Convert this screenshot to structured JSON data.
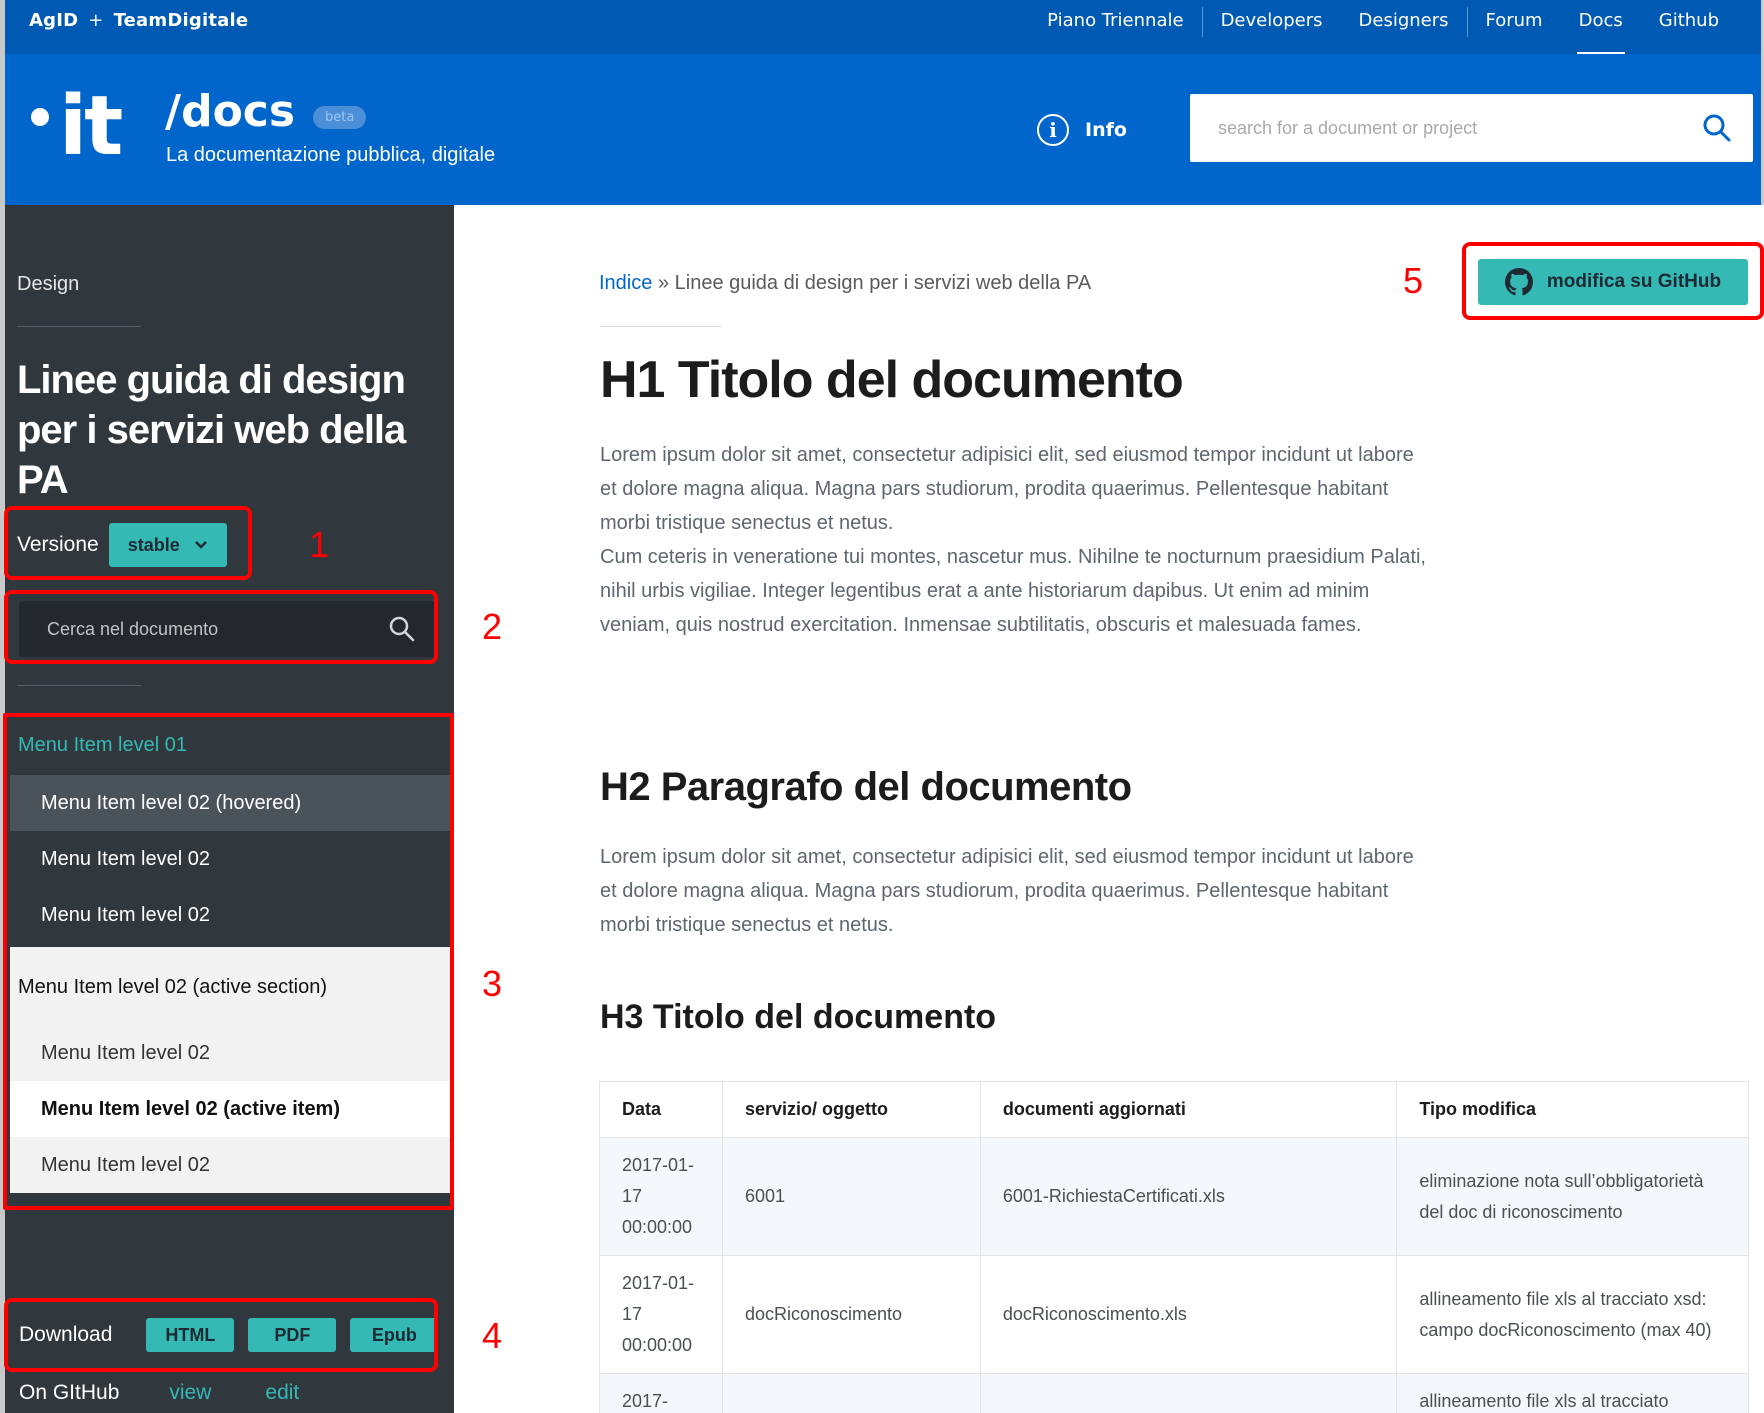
{
  "topbar": {
    "brand_left": "AgID",
    "brand_plus": "+",
    "brand_right": "TeamDigitale",
    "nav": [
      "Piano Triennale",
      "Developers",
      "Designers",
      "Forum",
      "Docs",
      "Github"
    ],
    "active": "Docs"
  },
  "header": {
    "logo": "it",
    "title": "/docs",
    "badge": "beta",
    "subtitle": "La documentazione pubblica, digitale",
    "info_label": "Info",
    "search_placeholder": "search for a document or project"
  },
  "sidebar": {
    "category": "Design",
    "title": "Linee guida di design per i servizi web della PA",
    "version_label": "Versione",
    "version_value": "stable",
    "search_placeholder": "Cerca nel documento",
    "menu": {
      "level1": "Menu Item level 01",
      "items_a": [
        "Menu Item level 02 (hovered)",
        "Menu Item level 02",
        "Menu Item level 02"
      ],
      "active_section": "Menu Item level 02 (active section)",
      "items_b": [
        "Menu Item level 02",
        "Menu Item level 02 (active item)",
        "Menu Item level 02"
      ]
    },
    "download_label": "Download",
    "download_buttons": [
      "HTML",
      "PDF",
      "Epub"
    ],
    "github_label": "On GItHub",
    "github_links": [
      "view",
      "edit"
    ]
  },
  "main": {
    "breadcrumb_link": "Indice",
    "breadcrumb_sep": "»",
    "breadcrumb_current": "Linee guida di design per i servizi web della PA",
    "edit_button": "modifica su GitHub",
    "h1": "H1 Titolo del documento",
    "p1_a": "Lorem ipsum dolor sit amet, consectetur adipisici elit, sed eiusmod tempor incidunt ut labore et dolore magna aliqua. Magna pars studiorum, prodita quaerimus. Pellentesque habitant morbi tristique senectus et netus.",
    "p1_b": "Cum ceteris in veneratione tui montes, nascetur mus. Nihilne te nocturnum praesidium Palati, nihil urbis vigiliae. Integer legentibus erat a ante historiarum dapibus. Ut enim ad minim veniam, quis nostrud exercitation. Inmensae subtilitatis, obscuris et malesuada fames.",
    "h2": "H2 Paragrafo del documento",
    "p2": "Lorem ipsum dolor sit amet, consectetur adipisici elit, sed eiusmod tempor incidunt ut labore et dolore magna aliqua. Magna pars studiorum, prodita quaerimus. Pellentesque habitant morbi tristique senectus et netus.",
    "h3": "H3 Titolo del documento",
    "table": {
      "headers": [
        "Data",
        "servizio/ oggetto",
        "documenti aggiornati",
        "Tipo modifica"
      ],
      "rows": [
        [
          "2017-01-17 00:00:00",
          "6001",
          "6001-RichiestaCertificati.xls",
          "eliminazione nota sull’obbligatorietà del doc di riconoscimento"
        ],
        [
          "2017-01-17 00:00:00",
          "docRiconoscimento",
          "docRiconoscimento.xls",
          "allineamento file xls al tracciato xsd: campo docRiconoscimento (max 40)"
        ],
        [
          "2017-",
          "",
          "",
          "allineamento file xls al tracciato"
        ]
      ]
    }
  },
  "annotations": [
    "1",
    "2",
    "3",
    "4",
    "5"
  ],
  "colors": {
    "primary": "#0066cc",
    "topbar": "#0059b3",
    "sidebar": "#30373d",
    "accent": "#34b9b4",
    "annotation": "#ff0000"
  }
}
